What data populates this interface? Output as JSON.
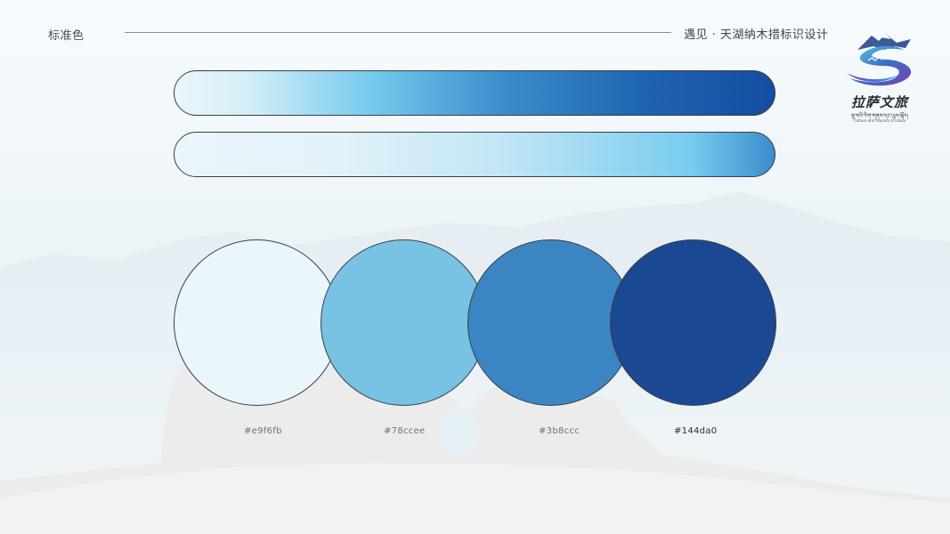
{
  "header": {
    "left_title": "标准色",
    "right_title": "遇见 · 天湖纳木措标识设计"
  },
  "logo": {
    "name_cn": "拉萨文旅",
    "name_tibetan": "ལྷ་སའི་རིག་གནས་དང་ཡུལ་སྐོར།",
    "name_en": "Culture and Tourism of Lhasa",
    "icon": "lhasa-s-mountain-logo-icon"
  },
  "gradients": [
    {
      "name": "primary-gradient",
      "stops": [
        "#e9f6fb",
        "#78ccee",
        "#3b8ccc",
        "#144da0"
      ]
    },
    {
      "name": "secondary-gradient",
      "stops": [
        "#e9f6fb",
        "#78ccee",
        "#3b8ccc"
      ]
    }
  ],
  "swatches": [
    {
      "hex_label": "#e9f6fb",
      "color": "#e9f6fb"
    },
    {
      "hex_label": "#78ccee",
      "color": "#78ccee"
    },
    {
      "hex_label": "#3b8ccc",
      "color": "#3b8ccc"
    },
    {
      "hex_label": "#144da0",
      "color": "#144da0"
    }
  ]
}
